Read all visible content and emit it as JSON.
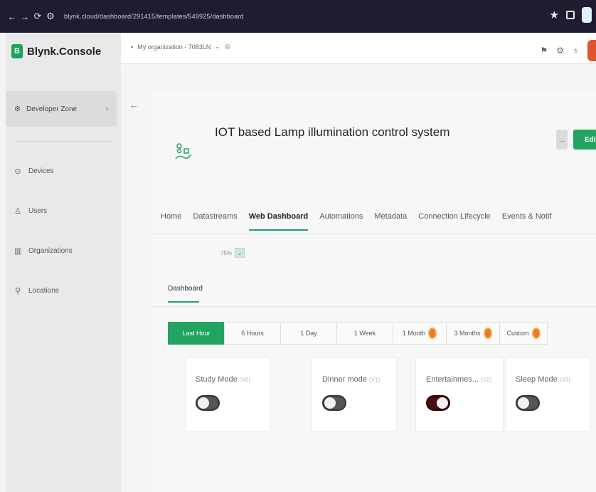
{
  "browser": {
    "url": "blynk.cloud/dashboard/291415/templates/549925/dashboard"
  },
  "sidebar": {
    "brand": "Blynk.Console",
    "developer_zone": "Developer Zone",
    "items": [
      {
        "label": "Devices",
        "icon": "devices-icon"
      },
      {
        "label": "Users",
        "icon": "users-icon"
      },
      {
        "label": "Organizations",
        "icon": "organizations-icon"
      },
      {
        "label": "Locations",
        "icon": "locations-icon"
      }
    ]
  },
  "topbar": {
    "org": "My organization - 7083LN"
  },
  "template": {
    "title": "IOT based Lamp illumination control system",
    "edit_label": "Edit",
    "more_label": "..."
  },
  "tabs": [
    {
      "label": "Home"
    },
    {
      "label": "Datastreams"
    },
    {
      "label": "Web Dashboard",
      "active": true
    },
    {
      "label": "Automations"
    },
    {
      "label": "Metadata"
    },
    {
      "label": "Connection Lifecycle"
    },
    {
      "label": "Events & Notif"
    }
  ],
  "zoom": {
    "value": "75%"
  },
  "dashboard_tab": "Dashboard",
  "time_ranges": [
    {
      "label": "Last Hour",
      "active": true
    },
    {
      "label": "6 Hours"
    },
    {
      "label": "1 Day"
    },
    {
      "label": "1 Week"
    },
    {
      "label": "1 Month",
      "pro": true
    },
    {
      "label": "3 Months",
      "pro": true
    },
    {
      "label": "Custom",
      "pro": true
    }
  ],
  "widgets": [
    {
      "label": "Study Mode",
      "pin": "(V0)",
      "state": "off"
    },
    {
      "label": "Dinner mode",
      "pin": "(V1)",
      "state": "off"
    },
    {
      "label": "Entertainmes...",
      "pin": "(V2)",
      "state": "on"
    },
    {
      "label": "Sleep Mode",
      "pin": "(V3)",
      "state": "off"
    }
  ],
  "colors": {
    "accent": "#22a361",
    "sidebar_bg": "#e9e9e9",
    "browser_bar": "#201b2e",
    "pro_badge": "#e87a28"
  }
}
